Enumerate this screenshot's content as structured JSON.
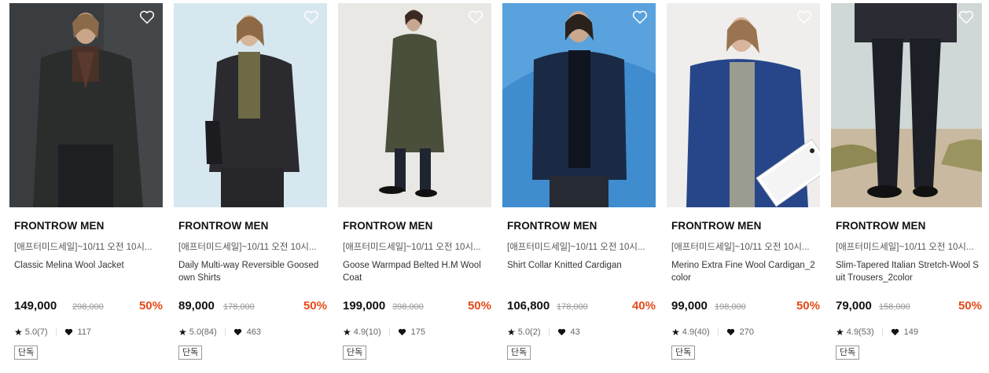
{
  "colors": {
    "discount": "#e64a19",
    "text": "#111111",
    "muted": "#999999"
  },
  "products": [
    {
      "brand": "FRONTROW MEN",
      "promo": "[애프터미드세일]~10/11 오전 10시...",
      "name": "Classic Melina Wool Jacket",
      "price": "149,000",
      "original_price": "298,000",
      "discount": "50%",
      "rating": "5.0(7)",
      "likes": "117",
      "badge": "단독",
      "image": "model-in-dark-wool-jacket-and-turtleneck",
      "wishlist_icon": "heart-outline-icon"
    },
    {
      "brand": "FRONTROW MEN",
      "promo": "[애프터미드세일]~10/11 오전 10시...",
      "name": "Daily Multi-way Reversible Goosed own Shirts",
      "price": "89,000",
      "original_price": "178,000",
      "discount": "50%",
      "rating": "5.0(84)",
      "likes": "463",
      "badge": "단독",
      "image": "model-in-black-padded-shirt-jacket",
      "wishlist_icon": "heart-outline-icon"
    },
    {
      "brand": "FRONTROW MEN",
      "promo": "[애프터미드세일]~10/11 오전 10시...",
      "name": "Goose Warmpad Belted H.M Wool Coat",
      "price": "199,000",
      "original_price": "398,000",
      "discount": "50%",
      "rating": "4.9(10)",
      "likes": "175",
      "badge": "단독",
      "image": "model-in-long-olive-wool-coat",
      "wishlist_icon": "heart-outline-icon"
    },
    {
      "brand": "FRONTROW MEN",
      "promo": "[애프터미드세일]~10/11 오전 10시...",
      "name": "Shirt Collar Knitted Cardigan",
      "price": "106,800",
      "original_price": "178,000",
      "discount": "40%",
      "rating": "5.0(2)",
      "likes": "43",
      "badge": "단독",
      "image": "model-in-navy-knit-cardigan-blue-background",
      "wishlist_icon": "heart-outline-icon"
    },
    {
      "brand": "FRONTROW MEN",
      "promo": "[애프터미드세일]~10/11 오전 10시...",
      "name": "Merino Extra Fine Wool Cardigan_2color",
      "price": "99,000",
      "original_price": "198,000",
      "discount": "50%",
      "rating": "4.9(40)",
      "likes": "270",
      "badge": "단독",
      "image": "model-in-blue-wool-cardigan-with-package-box",
      "wishlist_icon": "heart-outline-icon"
    },
    {
      "brand": "FRONTROW MEN",
      "promo": "[애프터미드세일]~10/11 오전 10시...",
      "name": "Slim-Tapered Italian Stretch-Wool Suit Trousers_2color",
      "price": "79,000",
      "original_price": "158,000",
      "discount": "50%",
      "rating": "4.9(53)",
      "likes": "149",
      "badge": "단독",
      "image": "model-legs-in-black-trousers-outdoors",
      "wishlist_icon": "heart-outline-icon"
    }
  ]
}
